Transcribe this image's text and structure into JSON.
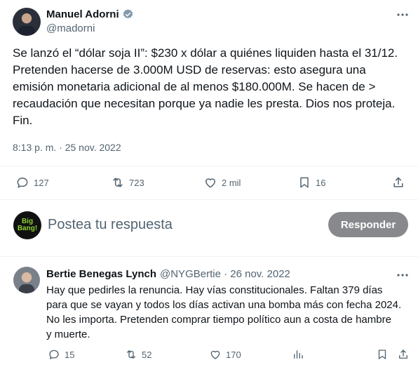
{
  "main_tweet": {
    "author_name": "Manuel Adorni",
    "handle": "@madorni",
    "more_icon": "more-icon",
    "text_lines": [
      "Se lanzó el “dólar soja II”: $230 x dólar a quiénes liquiden hasta el 31/12.",
      "Pretenden hacerse de 3.000M USD de reservas: esto asegura una",
      "emisión monetaria adicional de al menos $180.000M. Se hacen de >",
      "recaudación que necesitan porque ya nadie les presta. Dios nos proteja.",
      "Fin."
    ],
    "timestamp": "8:13 p. m. · 25 nov. 2022",
    "replies": "127",
    "retweets": "723",
    "likes": "2 mil",
    "bookmarks": "16"
  },
  "reply_box": {
    "placeholder": "Postea tu respuesta",
    "button_label": "Responder",
    "avatar_text_1": "Big",
    "avatar_text_2": "Bang!"
  },
  "reply_tweet": {
    "author_name": "Bertie Benegas Lynch",
    "handle_date": "@NYGBertie · 26 nov. 2022",
    "text_lines": [
      "Hay que pedirles la renuncia. Hay vías constitucionales. Faltan 379 días",
      "para que se vayan y todos los días activan una bomba más con fecha 2024.",
      "No les importa. Pretenden comprar tiempo político aun a costa de hambre",
      "y muerte."
    ],
    "replies": "15",
    "retweets": "52",
    "likes": "170"
  },
  "colors": {
    "verified": "#829aab",
    "text": "#0f1419",
    "muted": "#536471",
    "button_bg": "#87898c"
  }
}
